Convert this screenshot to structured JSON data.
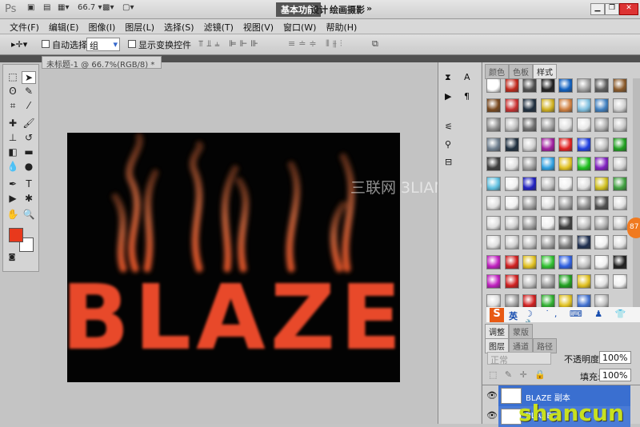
{
  "titlebar": {
    "logo": "Ps",
    "zoom": "66.7",
    "workspaces": [
      "基本功能",
      "设计",
      "绘画",
      "摄影"
    ],
    "more": "»"
  },
  "menu": [
    "文件(F)",
    "编辑(E)",
    "图像(I)",
    "图层(L)",
    "选择(S)",
    "滤镜(T)",
    "视图(V)",
    "窗口(W)",
    "帮助(H)"
  ],
  "options": {
    "auto_select_label": "自动选择:",
    "auto_select_value": "组",
    "show_transform_label": "显示变换控件"
  },
  "document": {
    "tab_title": "未标题-1 @ 66.7%(RGB/8) *",
    "text": "BLAZE"
  },
  "watermark": "三联网 3LIAN.COM",
  "colors": {
    "foreground": "#e8391c",
    "background": "#ffffff",
    "accent": "#3a6fd0"
  },
  "styles_panel": {
    "tabs": [
      "颜色",
      "色板",
      "样式"
    ],
    "active": "样式",
    "swatches": [
      "#ffffff",
      "#c0281c",
      "#505050",
      "#222222",
      "#1060c0",
      "#a0a0a0",
      "#606060",
      "#8a5a2a",
      "#7a4a20",
      "#c83030",
      "#203040",
      "#d0b020",
      "#d08040",
      "#80c0e0",
      "#4080c0",
      "#d0d0d0",
      "#909090",
      "#c0c0c0",
      "#707070",
      "#a0a0a0",
      "#e0e0e0",
      "#e8e8e8",
      "#b0b0b0",
      "#c8c8c8",
      "#708090",
      "#203040",
      "#d0d0d0",
      "#a020a0",
      "#e02020",
      "#2040e0",
      "#c0c0c0",
      "#20a020",
      "#404040",
      "#e0e0e0",
      "#a0a0a0",
      "#30a0e0",
      "#e0c020",
      "#20c020",
      "#8020c0",
      "#d0d0d0",
      "#60c0e0",
      "#f0f0f0",
      "#2020c0",
      "#c0c0c0",
      "#f0f0f0",
      "#e0e0e0",
      "#d0c020",
      "#40a040",
      "#e0e0e0",
      "#f0f0f0",
      "#a0a0a0",
      "#e0e0e0",
      "#a0a0a0",
      "#909090",
      "#505050",
      "#e0e0e0",
      "#e0e0e0",
      "#d0d0d0",
      "#a0a0a0",
      "#f0f0f0",
      "#404040",
      "#c0c0c0",
      "#b0b0b0",
      "#d0d0d0",
      "#e0e0e0",
      "#d0d0d0",
      "#c0c0c0",
      "#a0a0a0",
      "#808080",
      "#203050",
      "#f0f0f0",
      "#e0e0e0",
      "#c020c0",
      "#d02020",
      "#e0c020",
      "#30c030",
      "#3060e0",
      "#c0c0c0",
      "#f0f0f0",
      "#202020",
      "#c020c0",
      "#d02020",
      "#c0c0c0",
      "#a0a0a0",
      "#20a020",
      "#e0c020",
      "#e0e0e0",
      "#f0f0f0",
      "#e0e0e0",
      "#a0a0a0",
      "#d02020",
      "#30b030",
      "#e0c020",
      "#4070d0",
      "#c0c0c0"
    ]
  },
  "ime": {
    "logo": "S",
    "mode": "英"
  },
  "adjust_tabs": [
    "调整",
    "蒙版"
  ],
  "layers_panel": {
    "tabs": [
      "图层",
      "通道",
      "路径"
    ],
    "blend": "正常",
    "opacity_label": "不透明度:",
    "opacity": "100%",
    "fill_label": "填充:",
    "fill": "100%",
    "layers": [
      {
        "name": "BLAZE 副本"
      },
      {
        "name": "BLAZE"
      }
    ]
  },
  "side_badge": "87"
}
